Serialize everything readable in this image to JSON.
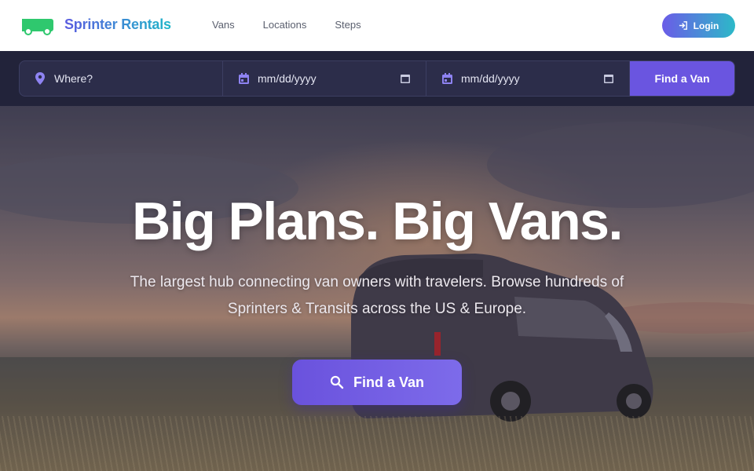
{
  "header": {
    "brand": "Sprinter Rentals",
    "logo_icon": "van-icon",
    "nav": [
      "Vans",
      "Locations",
      "Steps"
    ],
    "login_label": "Login",
    "login_icon": "login-icon",
    "accent_gradient": [
      "#6b5ce7",
      "#2cb9c8"
    ]
  },
  "search": {
    "where_placeholder": "Where?",
    "start_date": "mm/dd/yyyy",
    "end_date": "mm/dd/yyyy",
    "button_label": "Find a Van",
    "icons": [
      "location-pin-icon",
      "calendar-icon",
      "calendar-icon"
    ]
  },
  "hero": {
    "title": "Big Plans. Big Vans.",
    "subtitle": "The largest hub connecting van owners with travelers. Browse hundreds of Sprinters & Transits across the US & Europe.",
    "cta_label": "Find a Van",
    "cta_icon": "search-icon",
    "cta_color": "#6a55e0"
  }
}
